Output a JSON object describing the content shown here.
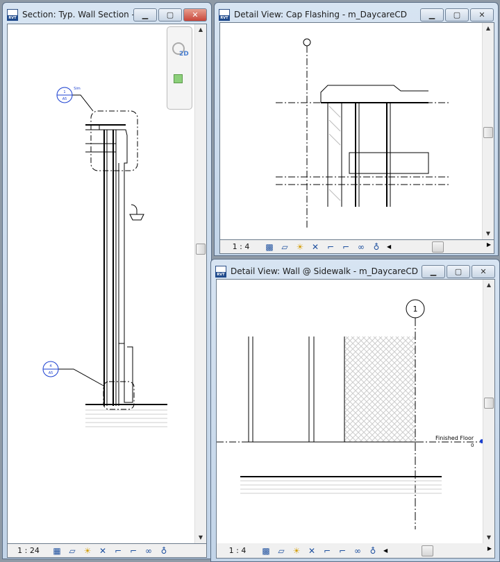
{
  "windows": [
    {
      "title": "Section: Typ. Wall Section - ...",
      "scale": "1 : 24",
      "callouts": [
        {
          "number": "1",
          "sheet": "A5",
          "note": "Sim"
        },
        {
          "number": "4",
          "sheet": "A5"
        }
      ]
    },
    {
      "title": "Detail View: Cap Flashing - m_DaycareCD",
      "scale": "1 : 4"
    },
    {
      "title": "Detail View: Wall @ Sidewalk - m_DaycareCD",
      "scale": "1 : 4",
      "grid_label": "1",
      "level": {
        "name": "Finished Floor",
        "elevation": "0"
      }
    }
  ],
  "buttons": {
    "minimize": "▁",
    "maximize": "▢",
    "close": "✕"
  },
  "nav_wheel": {
    "label": "2D"
  },
  "status_icons": [
    "detail-level-icon",
    "visual-style-icon",
    "sun-path-off-icon",
    "shadows-off-icon",
    "crop-view-icon",
    "show-crop-icon",
    "temporary-hide-icon",
    "reveal-hidden-icon"
  ],
  "colors": {
    "frame": "#c2d4e8",
    "close": "#c8463a",
    "annotation": "#1a3fd0"
  }
}
